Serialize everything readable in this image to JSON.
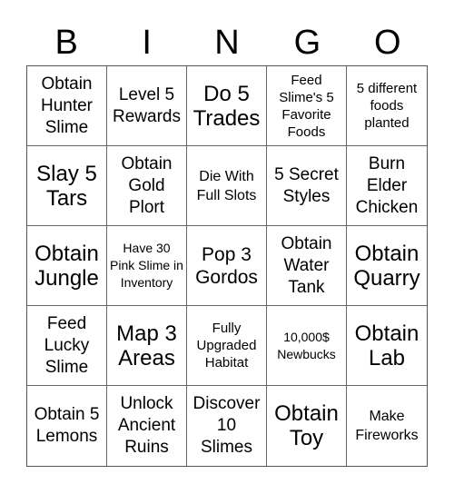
{
  "header": {
    "letters": [
      "B",
      "I",
      "N",
      "G",
      "O"
    ]
  },
  "board": {
    "cells": [
      [
        "Obtain Hunter Slime",
        "Level 5 Rewards",
        "Do 5 Trades",
        "Feed Slime's 5 Favorite Foods",
        "5 different foods planted"
      ],
      [
        "Slay 5 Tars",
        "Obtain Gold Plort",
        "Die With Full Slots",
        "5 Secret Styles",
        "Burn Elder Chicken"
      ],
      [
        "Obtain Jungle",
        "Have 30 Pink Slime in Inventory",
        "Pop 3 Gordos",
        "Obtain Water Tank",
        "Obtain Quarry"
      ],
      [
        "Feed Lucky Slime",
        "Map 3 Areas",
        "Fully Upgraded Habitat",
        "10,000$ Newbucks",
        "Obtain Lab"
      ],
      [
        "Obtain 5 Lemons",
        "Unlock Ancient Ruins",
        "Discover 10 Slimes",
        "Obtain Toy",
        "Make Fireworks"
      ]
    ]
  }
}
